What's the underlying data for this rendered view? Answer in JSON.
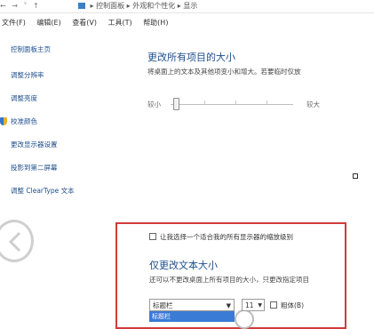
{
  "address_bar": {
    "nav": "← → ˅ ↑",
    "crumbs": [
      "控制面板",
      "外观和个性化",
      "显示"
    ],
    "separator": "▸"
  },
  "menu": {
    "file": "文件(F)",
    "edit": "编辑(E)",
    "view": "查看(V)",
    "tools": "工具(T)",
    "help": "帮助(H)"
  },
  "sidebar": {
    "items": [
      {
        "label": "控制面板主页"
      },
      {
        "label": "调整分辨率"
      },
      {
        "label": "调整亮度"
      },
      {
        "label": "校准颜色"
      },
      {
        "label": "更改显示器设置"
      },
      {
        "label": "投影到第二屏幕"
      },
      {
        "label": "调整 ClearType 文本"
      }
    ]
  },
  "main": {
    "title": "更改所有项目的大小",
    "description": "将桌面上的文本及其他项变小和增大。若要临时仅放",
    "slider": {
      "min_label": "较小",
      "max_label": "较大",
      "level": 0.0
    }
  },
  "custom_panel": {
    "checkbox_label": "让我选择一个适合我的所有显示器的缩放级别",
    "title": "仅更改文本大小",
    "description": "还可以不更改桌面上所有项目的大小，只更改指定项目",
    "item_select": {
      "value": "标题栏",
      "highlighted_option": "标题栏"
    },
    "size_select": {
      "value": "11"
    },
    "bold_label": "粗体(B)"
  }
}
